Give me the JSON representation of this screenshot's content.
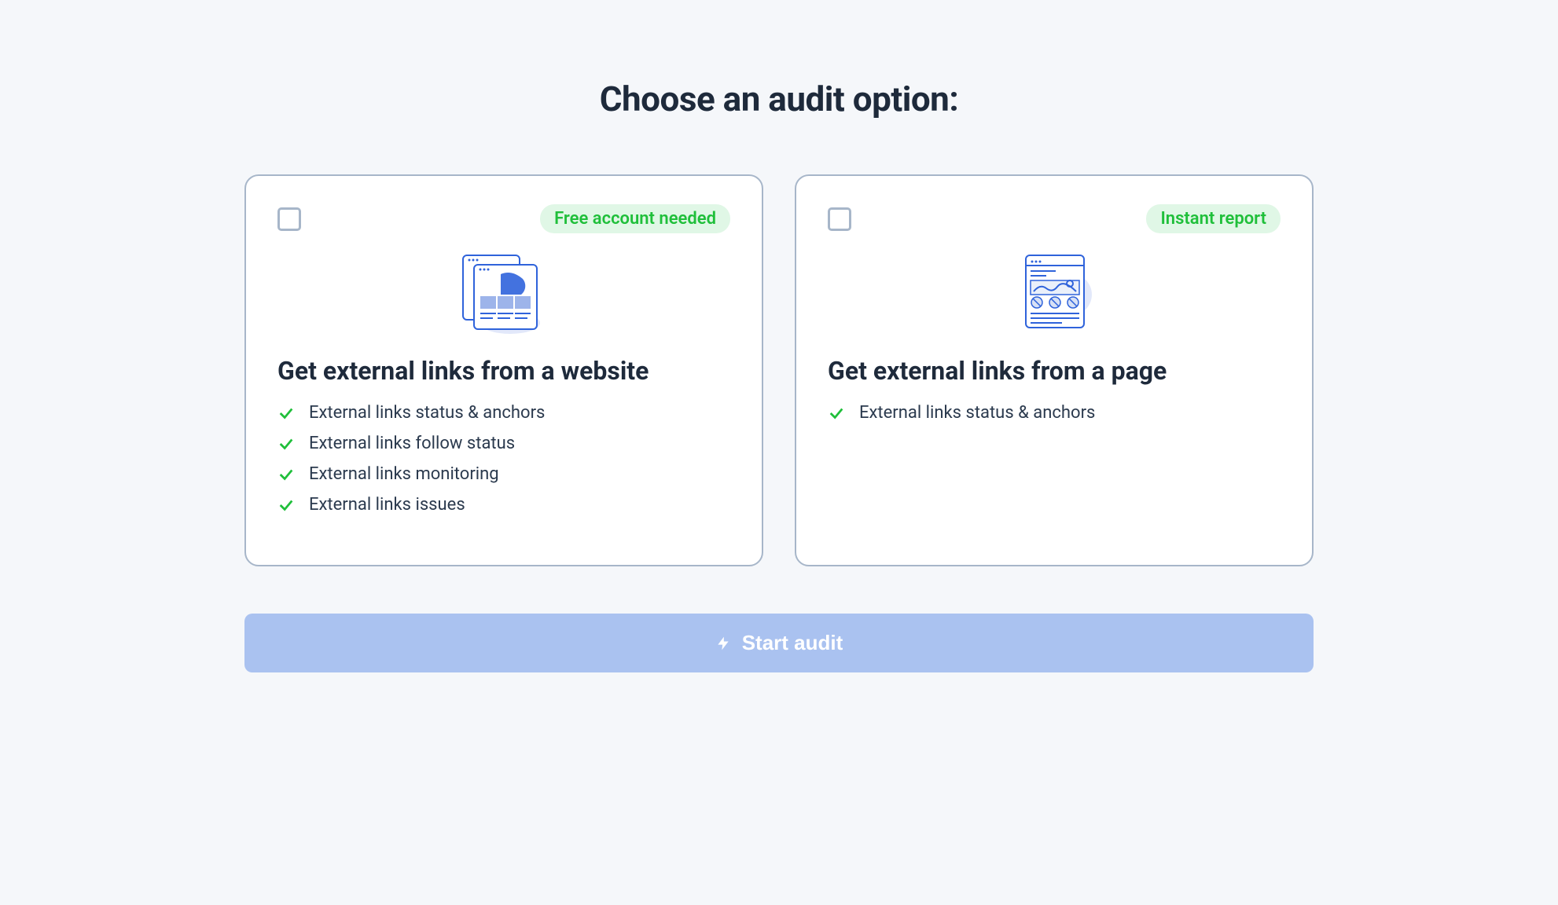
{
  "title": "Choose an audit option:",
  "options": [
    {
      "badge": "Free account needed",
      "heading": "Get external links from a website",
      "features": [
        "External links status & anchors",
        "External links follow status",
        "External links monitoring",
        "External links issues"
      ]
    },
    {
      "badge": "Instant report",
      "heading": "Get external links from a page",
      "features": [
        "External links status & anchors"
      ]
    }
  ],
  "cta": "Start audit"
}
